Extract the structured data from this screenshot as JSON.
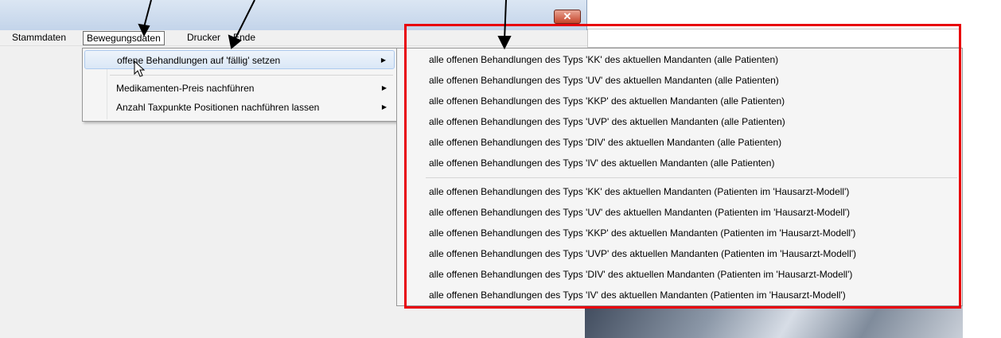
{
  "window": {
    "close_glyph": "✕"
  },
  "menubar": {
    "items": [
      {
        "label": "Stammdaten"
      },
      {
        "label": "Bewegungsdaten"
      },
      {
        "label": "Drucker"
      },
      {
        "label": "Ende"
      }
    ]
  },
  "submenu1": {
    "items": [
      {
        "label": "offene Behandlungen auf 'fällig' setzen"
      },
      {
        "label": "Medikamenten-Preis nachführen"
      },
      {
        "label": "Anzahl Taxpunkte Positionen nachführen lassen"
      }
    ],
    "arrow": "▶"
  },
  "submenu2": {
    "group1": [
      {
        "label": "alle offenen Behandlungen des Typs 'KK' des aktuellen Mandanten (alle Patienten)"
      },
      {
        "label": "alle offenen Behandlungen des Typs 'UV' des aktuellen Mandanten (alle Patienten)"
      },
      {
        "label": "alle offenen Behandlungen des Typs 'KKP' des aktuellen Mandanten (alle Patienten)"
      },
      {
        "label": "alle offenen Behandlungen des Typs 'UVP' des aktuellen Mandanten (alle Patienten)"
      },
      {
        "label": "alle offenen Behandlungen des Typs 'DIV' des aktuellen Mandanten (alle Patienten)"
      },
      {
        "label": "alle offenen Behandlungen des Typs 'IV' des aktuellen Mandanten (alle Patienten)"
      }
    ],
    "group2": [
      {
        "label": "alle offenen Behandlungen des Typs 'KK' des aktuellen Mandanten (Patienten im 'Hausarzt-Modell')"
      },
      {
        "label": "alle offenen Behandlungen des Typs 'UV' des aktuellen Mandanten (Patienten im 'Hausarzt-Modell')"
      },
      {
        "label": "alle offenen Behandlungen des Typs 'KKP' des aktuellen Mandanten (Patienten im 'Hausarzt-Modell')"
      },
      {
        "label": "alle offenen Behandlungen des Typs 'UVP' des aktuellen Mandanten (Patienten im 'Hausarzt-Modell')"
      },
      {
        "label": "alle offenen Behandlungen des Typs 'DIV' des aktuellen Mandanten (Patienten im 'Hausarzt-Modell')"
      },
      {
        "label": "alle offenen Behandlungen des Typs 'IV' des aktuellen Mandanten (Patienten im 'Hausarzt-Modell')"
      }
    ]
  },
  "colors": {
    "highlight_box": "#e8000b",
    "annotation_arrow": "#000000"
  }
}
